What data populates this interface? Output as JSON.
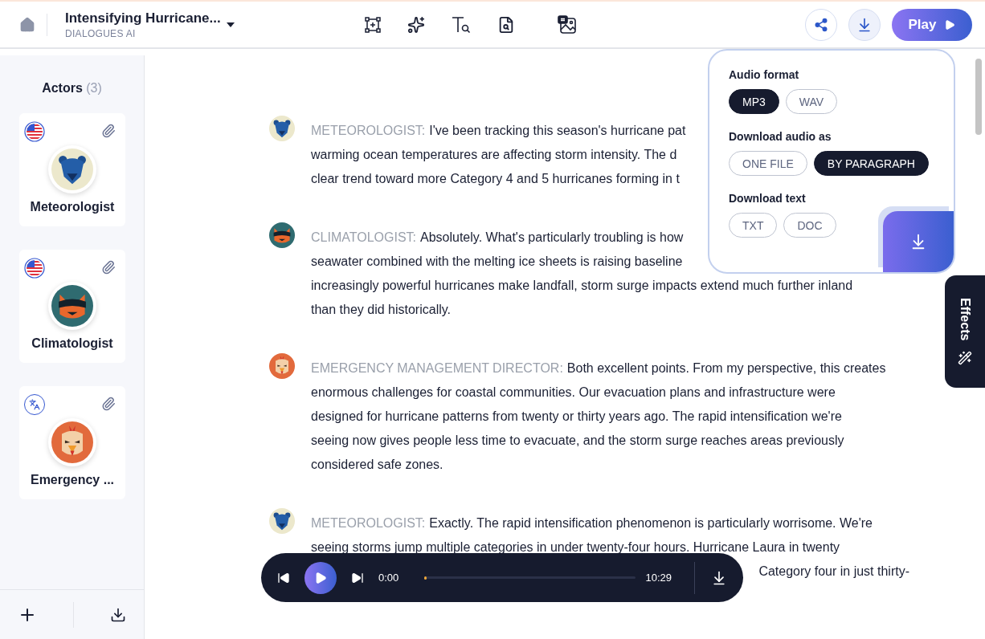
{
  "header": {
    "title": "Intensifying Hurricane...",
    "subtitle": "DIALOGUES AI",
    "download_open": true,
    "play_label": "Play"
  },
  "sidebar": {
    "title": "Actors",
    "count": "(3)",
    "actors": [
      {
        "name": "Meteorologist",
        "kind": "flag",
        "color": "#ece8cc"
      },
      {
        "name": "Climatologist",
        "kind": "flag",
        "color": "#2f6b70"
      },
      {
        "name": "Emergency ...",
        "kind": "translate",
        "color": "#e26a3c"
      }
    ]
  },
  "paragraphs": [
    {
      "speaker": "METEOROLOGIST:",
      "color": "#ece8cc",
      "lines": [
        {
          "kind": "full",
          "text": "I've been tracking this season's hurricane pat"
        },
        {
          "kind": "full",
          "text": "warming ocean temperatures are affecting storm intensity. The d"
        },
        {
          "kind": "full",
          "text": "clear trend toward more Category 4 and 5 hurricanes forming in t"
        }
      ]
    },
    {
      "speaker": "CLIMATOLOGIST:",
      "color": "#2f6b70",
      "lines": [
        {
          "kind": "full",
          "text": "Absolutely. What's particularly troubling is how"
        },
        {
          "kind": "full",
          "text": "seawater combined with the melting ice sheets is raising baseline"
        },
        {
          "kind": "full",
          "text": "increasingly powerful hurricanes make landfall, storm surge impacts extend much further inland"
        },
        {
          "kind": "full",
          "text": "than they did historically."
        }
      ]
    },
    {
      "speaker": "EMERGENCY MANAGEMENT DIRECTOR:",
      "color": "#e26a3c",
      "lines": [
        {
          "kind": "full",
          "text": "Both excellent points. From my perspective, this creates"
        },
        {
          "kind": "full",
          "text": "enormous challenges for coastal communities. Our evacuation plans and infrastructure were"
        },
        {
          "kind": "full",
          "text": "designed for hurricane patterns from twenty or thirty years ago. The rapid intensification we're"
        },
        {
          "kind": "full",
          "text": "seeing now gives people less time to evacuate, and the storm surge reaches areas previously"
        },
        {
          "kind": "full",
          "text": "considered safe zones."
        }
      ]
    },
    {
      "speaker": "METEOROLOGIST:",
      "color": "#ece8cc",
      "lines": [
        {
          "kind": "full",
          "text": "Exactly. The rapid intensification phenomenon is particularly worrisome. We're"
        },
        {
          "kind": "full",
          "text": "seeing storms jump multiple categories in under twenty-four hours. Hurricane Laura in twenty"
        },
        {
          "kind": "tail",
          "text": "Category four in just thirty-"
        }
      ]
    }
  ],
  "download_panel": {
    "sections": [
      {
        "title": "Audio format",
        "options": [
          {
            "label": "MP3",
            "selected": true
          },
          {
            "label": "WAV",
            "selected": false
          }
        ]
      },
      {
        "title": "Download audio as",
        "options": [
          {
            "label": "ONE FILE",
            "selected": false
          },
          {
            "label": "BY PARAGRAPH",
            "selected": true
          }
        ]
      },
      {
        "title": "Download text",
        "options": [
          {
            "label": "TXT",
            "selected": false
          },
          {
            "label": "DOC",
            "selected": false
          }
        ]
      }
    ]
  },
  "effects": {
    "label": "Effects"
  },
  "player": {
    "current": "0:00",
    "total": "10:29",
    "level": 0
  }
}
